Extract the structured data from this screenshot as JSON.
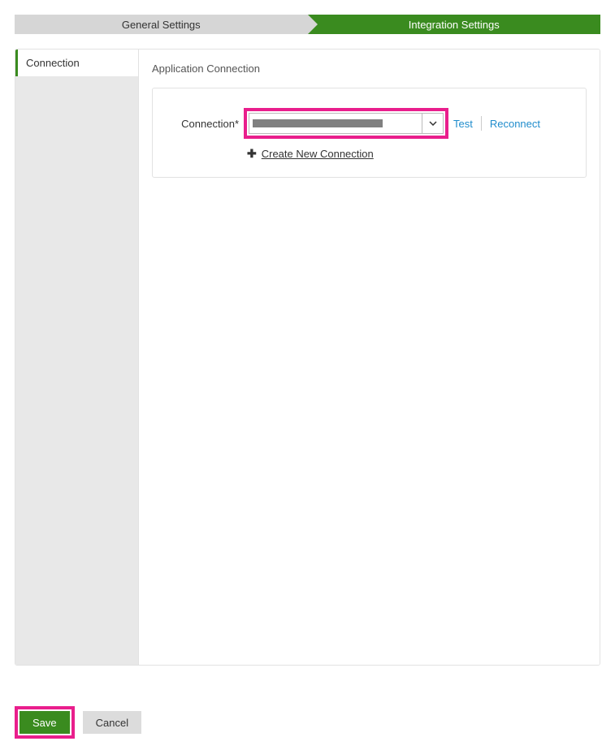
{
  "tabs": {
    "general": "General Settings",
    "integration": "Integration Settings"
  },
  "sidebar": {
    "items": [
      {
        "label": "Connection"
      }
    ]
  },
  "content": {
    "title": "Application Connection",
    "connection_label": "Connection*",
    "test_label": "Test",
    "reconnect_label": "Reconnect",
    "create_label": "Create New Connection"
  },
  "footer": {
    "save_label": "Save",
    "cancel_label": "Cancel"
  },
  "colors": {
    "accent_green": "#3a8b1f",
    "highlight_pink": "#e91e8c",
    "link_blue": "#1f8ccc"
  }
}
